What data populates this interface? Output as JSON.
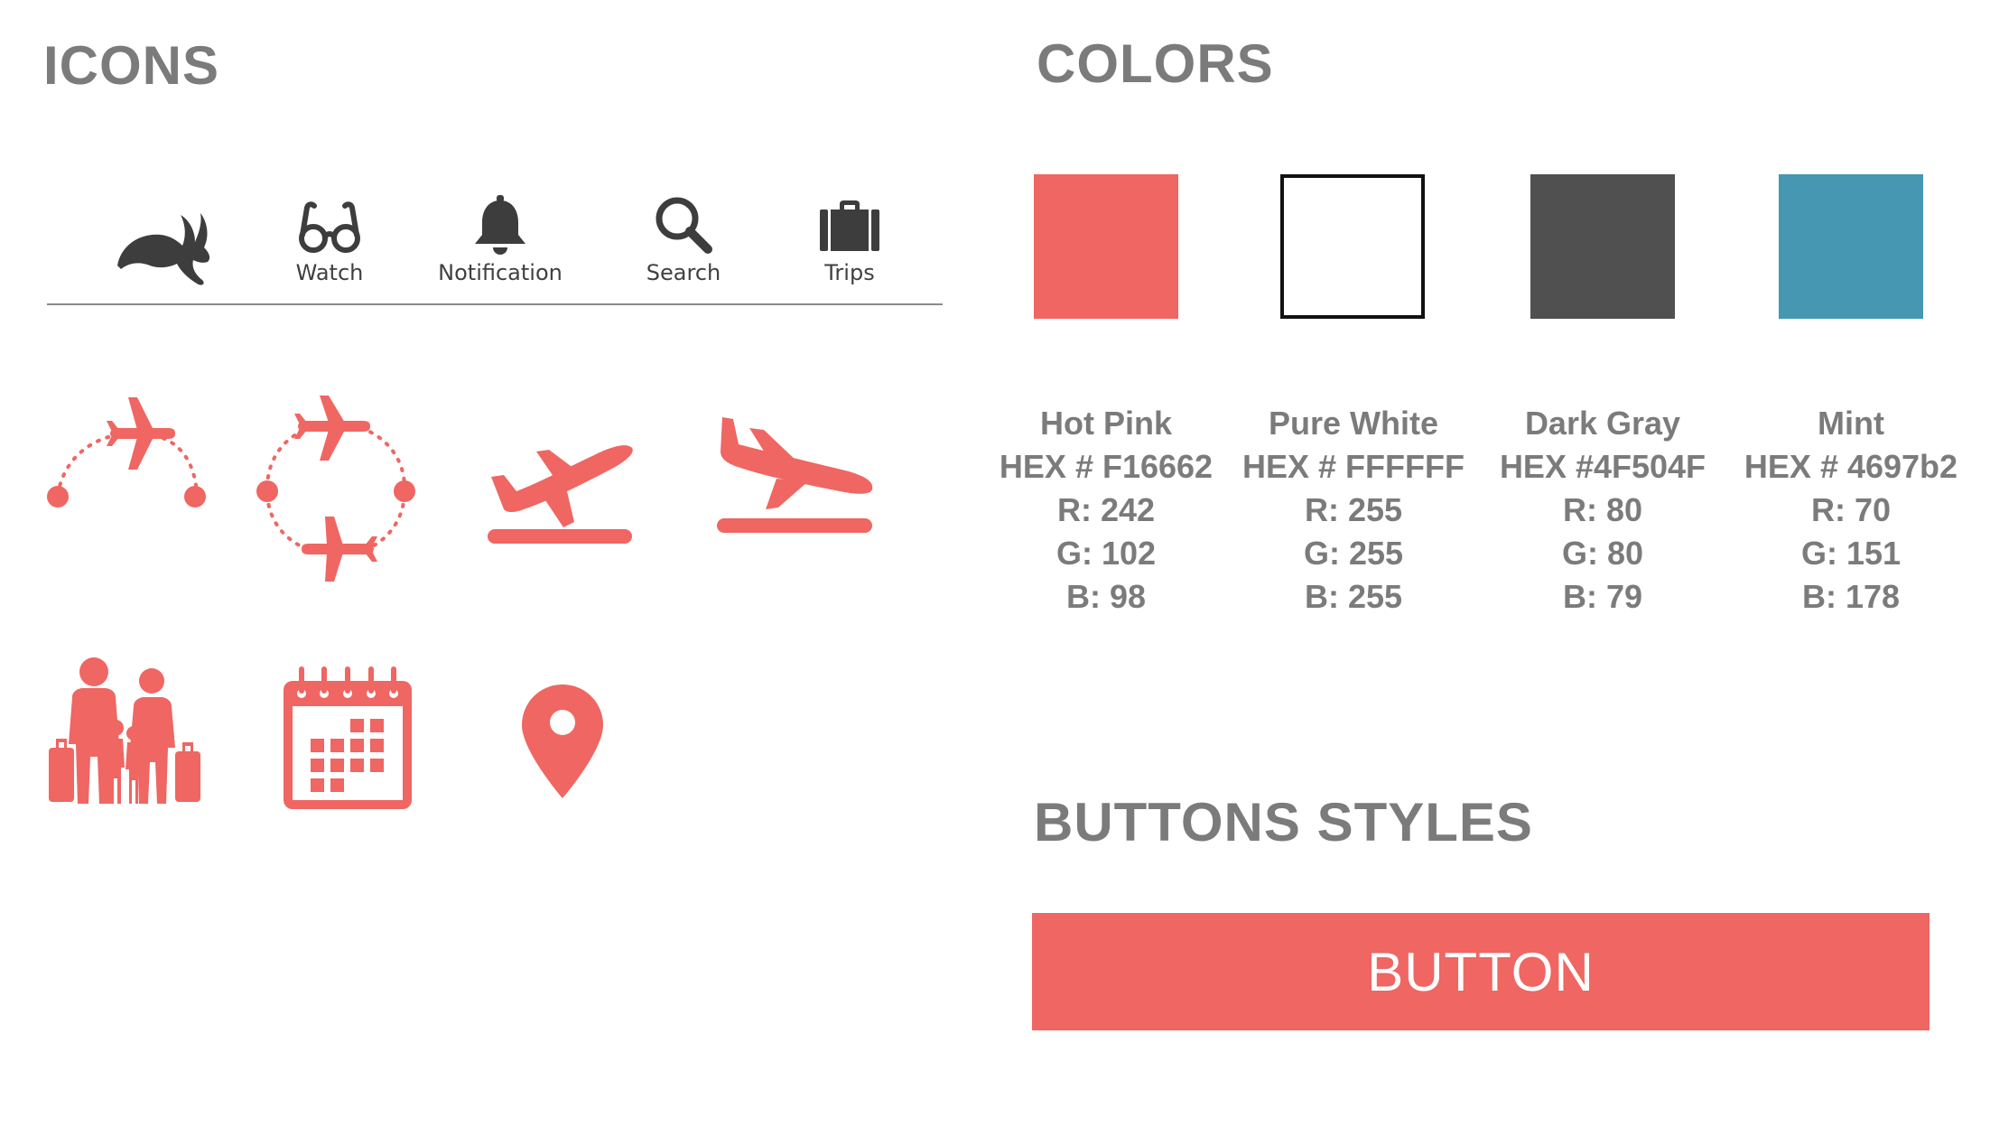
{
  "headings": {
    "icons": "ICONS",
    "colors": "COLORS",
    "buttons": "BUTTONS STYLES"
  },
  "nav": {
    "items": [
      {
        "icon": "rabbit-logo-icon",
        "label": ""
      },
      {
        "icon": "glasses-icon",
        "label": "Watch"
      },
      {
        "icon": "bell-icon",
        "label": "Notification"
      },
      {
        "icon": "search-icon",
        "label": "Search"
      },
      {
        "icon": "suitcase-icon",
        "label": "Trips"
      }
    ],
    "icon_color": "#3d3d3d"
  },
  "icon_grid": {
    "color": "#ef6662",
    "icons": [
      "one-way-flight-icon",
      "round-trip-flight-icon",
      "takeoff-icon",
      "landing-icon",
      "family-travelers-icon",
      "calendar-icon",
      "map-pin-icon"
    ]
  },
  "colors": [
    {
      "name": "Hot Pink",
      "hex": "HEX # F16662",
      "r": "R: 242",
      "g": "G: 102",
      "b": "B: 98",
      "swatch": "#ef6662"
    },
    {
      "name": "Pure White",
      "hex": "HEX # FFFFFF",
      "r": "R: 255",
      "g": "G: 255",
      "b": "B: 255",
      "swatch": "#ffffff"
    },
    {
      "name": "Dark Gray",
      "hex": "HEX #4F504F",
      "r": "R: 80",
      "g": "G: 80",
      "b": "B: 79",
      "swatch": "#4f504f"
    },
    {
      "name": "Mint",
      "hex": "HEX # 4697b2",
      "r": "R: 70",
      "g": "G: 151",
      "b": "B: 178",
      "swatch": "#4697b2"
    }
  ],
  "button": {
    "label": "BUTTON",
    "color": "#ef6662",
    "text_color": "#ffffff"
  }
}
